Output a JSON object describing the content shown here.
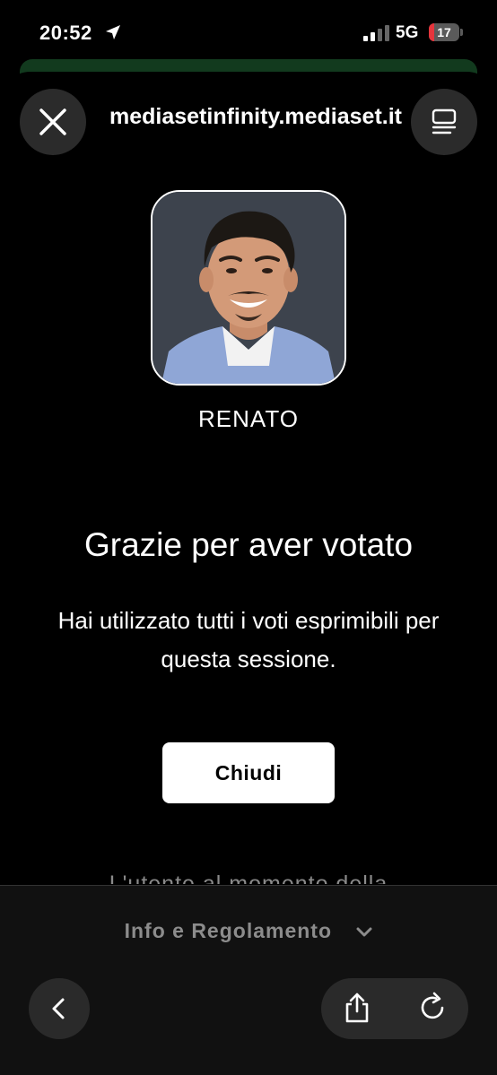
{
  "status_bar": {
    "time": "20:52",
    "network": "5G",
    "battery_level": "17",
    "battery_fill_fraction": 0.17,
    "battery_color": "#e5353c",
    "location_icon": "location-arrow-icon",
    "signal_icon": "cellular-signal-icon"
  },
  "browser": {
    "url": "mediasetinfinity.mediaset.it",
    "close_icon": "close-icon",
    "tabs_icon": "tabs-overview-icon"
  },
  "vote": {
    "candidate_name": "RENATO",
    "title": "Grazie per aver votato",
    "message": "Hai utilizzato tutti i voti esprimibili per questa sessione.",
    "close_button": "Chiudi",
    "truncated_text": "L'utente al momento della"
  },
  "footer": {
    "info_link": "Info e Regolamento",
    "info_icon": "chevron-down-icon",
    "back_icon": "chevron-left-icon",
    "share_icon": "share-icon",
    "reload_icon": "reload-icon"
  }
}
